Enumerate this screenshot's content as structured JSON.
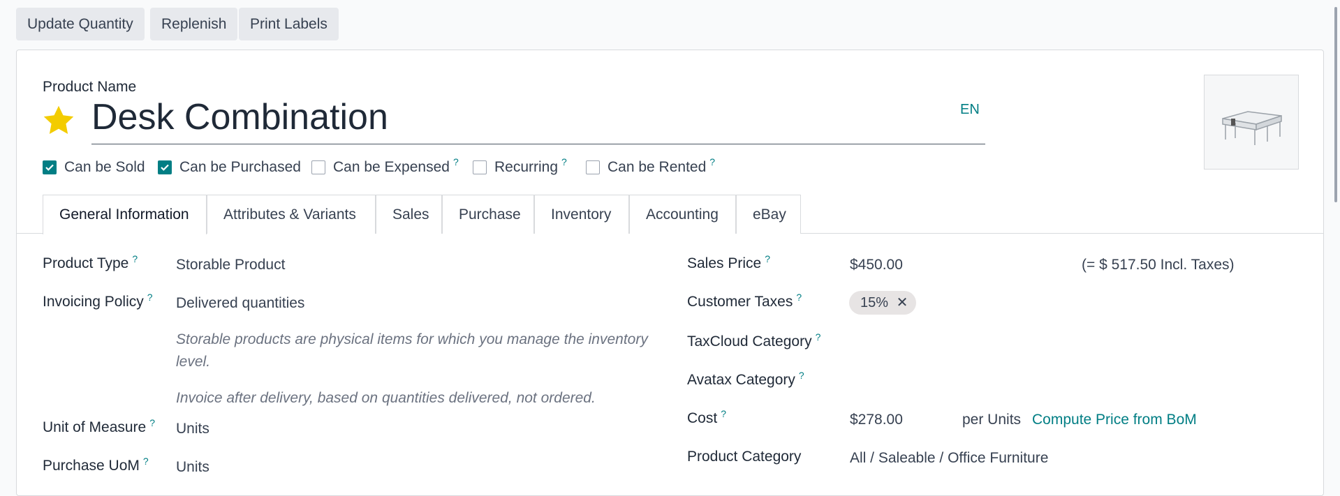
{
  "toolbar": {
    "update_quantity": "Update Quantity",
    "replenish": "Replenish",
    "print_labels": "Print Labels"
  },
  "product": {
    "name_label": "Product Name",
    "name": "Desk Combination",
    "lang": "EN",
    "favorite_icon": "star-icon",
    "image_icon": "desk-product-image"
  },
  "flags": [
    {
      "label": "Can be Sold",
      "checked": true,
      "help": ""
    },
    {
      "label": "Can be Purchased",
      "checked": true,
      "help": ""
    },
    {
      "label": "Can be Expensed",
      "checked": false,
      "help": "?"
    },
    {
      "label": "Recurring",
      "checked": false,
      "help": "?"
    },
    {
      "label": "Can be Rented",
      "checked": false,
      "help": "?"
    }
  ],
  "tabs": [
    {
      "label": "General Information",
      "active": true
    },
    {
      "label": "Attributes & Variants",
      "active": false
    },
    {
      "label": "Sales",
      "active": false
    },
    {
      "label": "Purchase",
      "active": false
    },
    {
      "label": "Inventory",
      "active": false
    },
    {
      "label": "Accounting",
      "active": false
    },
    {
      "label": "eBay",
      "active": false
    }
  ],
  "left": {
    "product_type_label": "Product Type",
    "product_type": "Storable Product",
    "invoicing_policy_label": "Invoicing Policy",
    "invoicing_policy": "Delivered quantities",
    "note_storable": "Storable products are physical items for which you manage the inventory level.",
    "note_invoice": "Invoice after delivery, based on quantities delivered, not ordered.",
    "uom_label": "Unit of Measure",
    "uom": "Units",
    "purchase_uom_label": "Purchase UoM",
    "purchase_uom": "Units",
    "help": "?"
  },
  "right": {
    "sales_price_label": "Sales Price",
    "sales_price": "$450.00",
    "incl_taxes": "(= $ 517.50 Incl. Taxes)",
    "customer_taxes_label": "Customer Taxes",
    "tax_badge": "15%",
    "tax_remove": "✕",
    "taxcloud_label": "TaxCloud Category",
    "avatax_label": "Avatax Category",
    "cost_label": "Cost",
    "cost": "$278.00",
    "per_units": "per Units",
    "compute_price": "Compute Price from BoM",
    "category_label": "Product Category",
    "category": "All / Saleable / Office Furniture",
    "help": "?"
  },
  "colors": {
    "accent": "#017e84",
    "star": "#f3cc00"
  }
}
